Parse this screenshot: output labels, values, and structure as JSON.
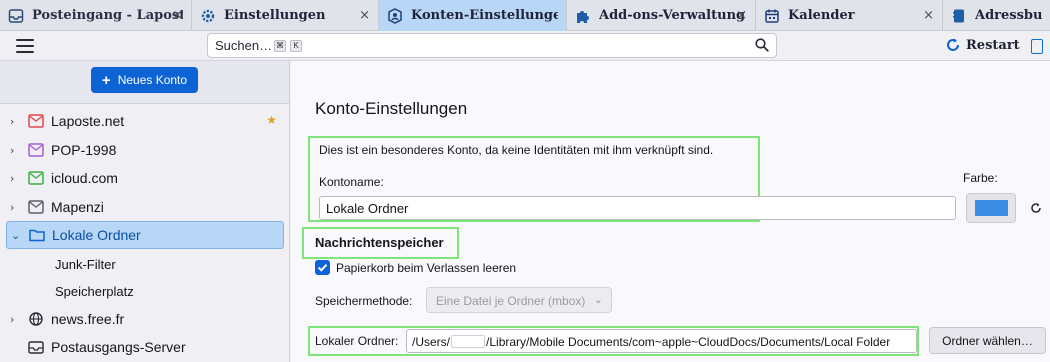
{
  "tabs": [
    {
      "label": "Posteingang - Laposte.net",
      "icon": "inbox-icon"
    },
    {
      "label": "Einstellungen",
      "icon": "gear-icon"
    },
    {
      "label": "Konten-Einstellungen",
      "icon": "account-settings-icon",
      "active": true
    },
    {
      "label": "Add-ons-Verwaltung",
      "icon": "puzzle-icon"
    },
    {
      "label": "Kalender",
      "icon": "calendar-icon"
    },
    {
      "label": "Adressbuch",
      "icon": "address-book-icon"
    }
  ],
  "close_glyph": "×",
  "toolbar": {
    "search_placeholder": "Suchen…",
    "kbd1": "⌘",
    "kbd2": "K",
    "restart_label": "Restart"
  },
  "sidebar": {
    "new_account_label": "Neues Konto",
    "accounts": [
      {
        "label": "Laposte.net",
        "icon": "mail-account-icon",
        "color": "#e0454d",
        "starred": true
      },
      {
        "label": "POP-1998",
        "icon": "mail-account-icon",
        "color": "#a35ed6"
      },
      {
        "label": "icloud.com",
        "icon": "mail-account-icon",
        "color": "#3cb043"
      },
      {
        "label": "Mapenzi",
        "icon": "mail-account-icon",
        "color": "#5b5d6b"
      },
      {
        "label": "Lokale Ordner",
        "icon": "folder-icon",
        "color": "#0b63d6",
        "selected": true
      },
      {
        "label": "Junk-Filter",
        "sub": true
      },
      {
        "label": "Speicherplatz",
        "sub": true
      },
      {
        "label": "news.free.fr",
        "icon": "globe-icon",
        "color": "#2a2a35"
      },
      {
        "label": "Postausgangs-Server",
        "icon": "outbox-icon",
        "color": "#2a2a35",
        "nochevron": true
      }
    ]
  },
  "main": {
    "title": "Konto-Einstellungen",
    "info": "Dies ist ein besonderes Konto, da keine Identitäten mit ihm verknüpft sind.",
    "account_name_label": "Kontoname:",
    "account_name_value": "Lokale Ordner",
    "color_label": "Farbe:",
    "account_color": "#3c8de6",
    "storage_heading": "Nachrichtenspeicher",
    "empty_trash_label": "Papierkorb beim Verlassen leeren",
    "empty_trash_checked": true,
    "storage_method_label": "Speichermethode:",
    "storage_method_value": "Eine Datei je Ordner (mbox)",
    "local_folder_label": "Lokaler Ordner:",
    "local_folder_path_prefix": "/Users/",
    "local_folder_path_suffix": "/Library/Mobile Documents/com~apple~CloudDocs/Documents/Local Folder",
    "choose_folder_button": "Ordner wählen…"
  },
  "highlight_color": "#7ee57a"
}
